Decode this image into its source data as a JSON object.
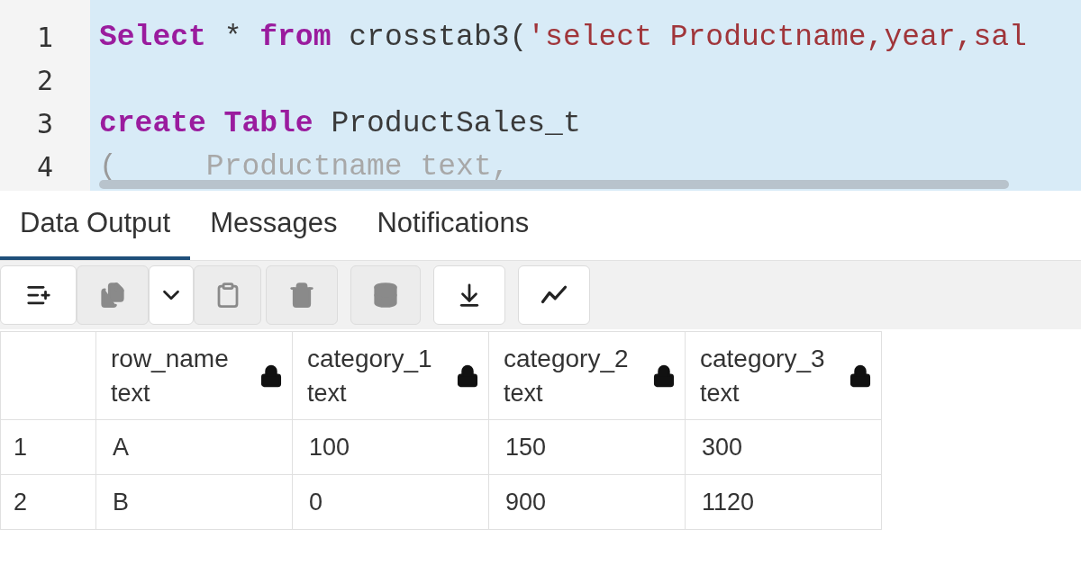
{
  "editor": {
    "lines": [
      {
        "number": "1",
        "tokens": [
          {
            "kind": "keyword",
            "text": "Select"
          },
          {
            "kind": "plain",
            "text": " * "
          },
          {
            "kind": "keyword",
            "text": "from"
          },
          {
            "kind": "plain",
            "text": " crosstab3("
          },
          {
            "kind": "string",
            "text": "'select Productname,year,sal"
          }
        ]
      },
      {
        "number": "2"
      },
      {
        "number": "3",
        "tokens": [
          {
            "kind": "keyword",
            "text": "create Table"
          },
          {
            "kind": "plain",
            "text": " ProductSales_t"
          }
        ]
      },
      {
        "number": "4",
        "tokens": [
          {
            "kind": "punct",
            "text": "(     "
          },
          {
            "kind": "faded",
            "text": "Productname text,"
          }
        ]
      }
    ]
  },
  "tabs": [
    {
      "label": "Data Output",
      "selected": true
    },
    {
      "label": "Messages",
      "selected": false
    },
    {
      "label": "Notifications",
      "selected": false
    }
  ],
  "toolbar": [
    {
      "kind": "add-row",
      "disabled": false
    },
    {
      "kind": "copy",
      "disabled": true
    },
    {
      "kind": "dropdown",
      "disabled": false
    },
    {
      "kind": "paste",
      "disabled": true
    },
    {
      "kind": "delete",
      "disabled": true
    },
    {
      "kind": "save-data",
      "disabled": true
    },
    {
      "kind": "download",
      "disabled": false
    },
    {
      "kind": "graph",
      "disabled": false
    }
  ],
  "table": {
    "columns": [
      {
        "name": "row_name",
        "type": "text"
      },
      {
        "name": "category_1",
        "type": "text"
      },
      {
        "name": "category_2",
        "type": "text"
      },
      {
        "name": "category_3",
        "type": "text"
      }
    ],
    "rows": [
      {
        "number": "1",
        "cells": [
          "A",
          "100",
          "150",
          "300"
        ]
      },
      {
        "number": "2",
        "cells": [
          "B",
          "0",
          "900",
          "1120"
        ]
      }
    ]
  }
}
